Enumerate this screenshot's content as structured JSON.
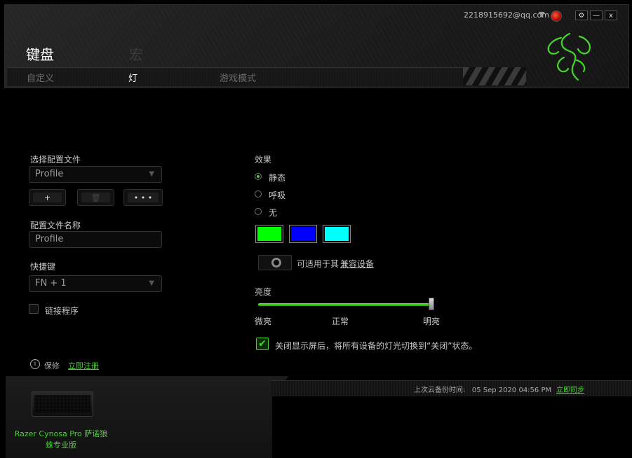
{
  "header": {
    "account_email": "2218915692@qq.com",
    "tabs": [
      "键盘",
      "宏"
    ],
    "subtabs": [
      "自定义",
      "灯",
      "游戏模式"
    ],
    "window_buttons": [
      "⚙",
      "—",
      "x"
    ]
  },
  "profile": {
    "select_label": "选择配置文件",
    "select_value": "Profile",
    "buttons": [
      "+",
      "🗑",
      "• • •"
    ],
    "name_label": "配置文件名称",
    "name_value": "Profile",
    "shortcut_label": "快捷键",
    "shortcut_value": "FN + 1",
    "link_program_label": "链接程序"
  },
  "effects": {
    "label": "效果",
    "options": [
      "静态",
      "呼吸",
      "无"
    ],
    "selected": "静态",
    "swatch_colors": [
      "#00ff00",
      "#0000ff",
      "#00ffff"
    ],
    "compat_text": "可适用于其",
    "compat_link": "兼容设备"
  },
  "brightness": {
    "label": "亮度",
    "ticks": [
      "微亮",
      "正常",
      "明亮"
    ],
    "value_fraction": 1.0
  },
  "screen_off": {
    "checked": true,
    "label": "关闭显示屏后，将所有设备的灯光切换到“关闭”状态。"
  },
  "footer": {
    "save_label": "保修",
    "register_link": "立即注册",
    "sync_info": "上次云备份时间:   05 Sep 2020 04:56 PM",
    "sync_link": "立即同步",
    "device_name": "Razer Cynosa Pro 萨诺狼蛛专业版"
  },
  "colors": {
    "accent": "#44d62c"
  }
}
